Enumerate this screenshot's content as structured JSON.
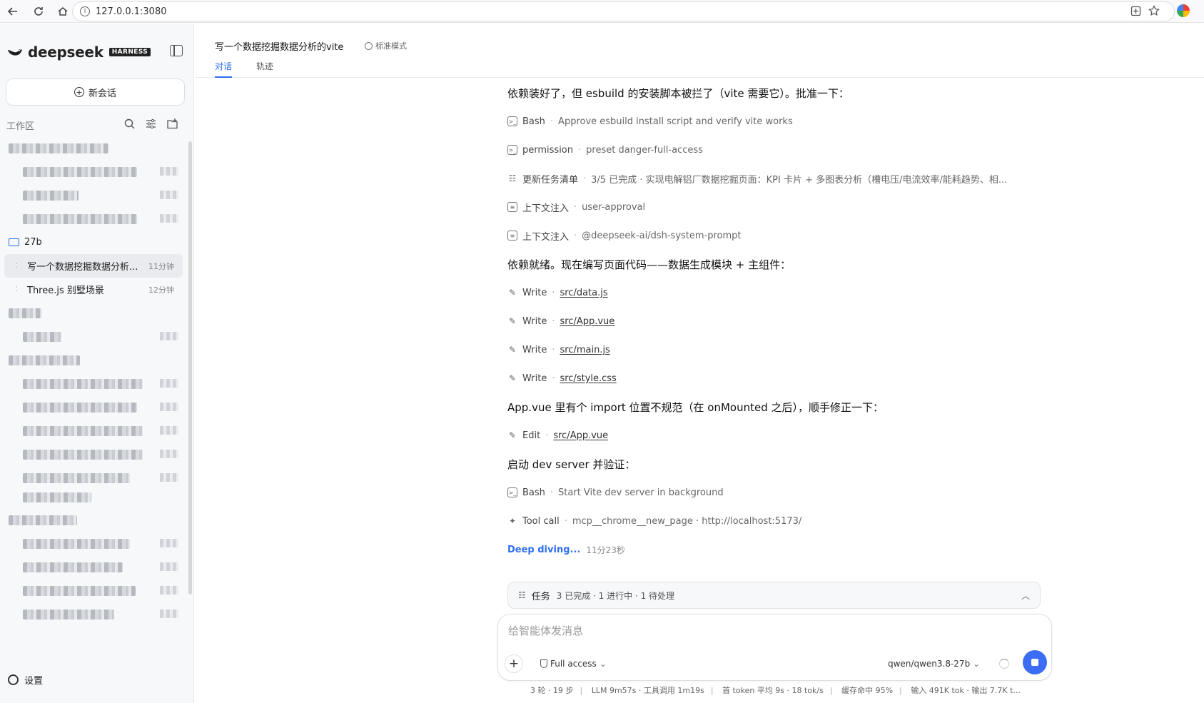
{
  "browser": {
    "url": "127.0.0.1:3080",
    "back_icon": "arrow-left-icon",
    "reload_icon": "reload-icon",
    "home_icon": "home-icon"
  },
  "sidebar": {
    "brand": "deepseek",
    "badge": "HARNESS",
    "new_chat": "新会话",
    "workspace_label": "工作区",
    "folder_name": "27b",
    "chats": [
      {
        "title": "写一个数据挖掘数据分析...",
        "time": "11分钟"
      },
      {
        "title": "Three.js 别墅场景",
        "time": "12分钟"
      }
    ],
    "settings": "设置"
  },
  "header": {
    "title": "写一个数据挖掘数据分析的vite",
    "mode": "标准模式",
    "tabs": [
      "对话",
      "轨迹"
    ]
  },
  "conversation": {
    "msg1": "依赖装好了，但 esbuild 的安装脚本被拦了（vite 需要它）。批准一下：",
    "tools1": [
      {
        "name": "Bash",
        "detail": "Approve esbuild install script and verify vite works"
      },
      {
        "name": "permission",
        "detail": "preset danger-full-access"
      },
      {
        "name": "更新任务清单",
        "detail": "3/5 已完成 · 实现电解铝厂数据挖掘页面：KPI 卡片 + 多图表分析（槽电压/电流效率/能耗趋势、相..."
      },
      {
        "name": "上下文注入",
        "detail": "user-approval"
      },
      {
        "name": "上下文注入",
        "detail": "@deepseek-ai/dsh-system-prompt"
      }
    ],
    "msg2": "依赖就绪。现在编写页面代码——数据生成模块 + 主组件：",
    "writes": [
      {
        "name": "Write",
        "file": "src/data.js"
      },
      {
        "name": "Write",
        "file": "src/App.vue"
      },
      {
        "name": "Write",
        "file": "src/main.js"
      },
      {
        "name": "Write",
        "file": "src/style.css"
      }
    ],
    "msg3": "App.vue 里有个 import 位置不规范（在 onMounted 之后），顺手修正一下：",
    "edit": {
      "name": "Edit",
      "file": "src/App.vue"
    },
    "msg4": "启动 dev server 并验证：",
    "tools2": [
      {
        "name": "Bash",
        "detail": "Start Vite dev server in background"
      },
      {
        "name": "Tool call",
        "detail": "mcp__chrome__new_page · http://localhost:5173/"
      }
    ],
    "deep_diving": "Deep diving...",
    "elapsed": "11分23秒"
  },
  "tasks": {
    "label": "任务",
    "summary": "3 已完成 · 1 进行中 · 1 待处理"
  },
  "composer": {
    "placeholder": "给智能体发消息",
    "access": "Full access",
    "model": "qwen/qwen3.8-27b"
  },
  "status": [
    "3 轮 · 19 步",
    "LLM 9m57s · 工具调用 1m19s",
    "首 token 平均 9s · 18 tok/s",
    "缓存命中 95%",
    "输入 491K tok · 输出 7.7K t..."
  ]
}
